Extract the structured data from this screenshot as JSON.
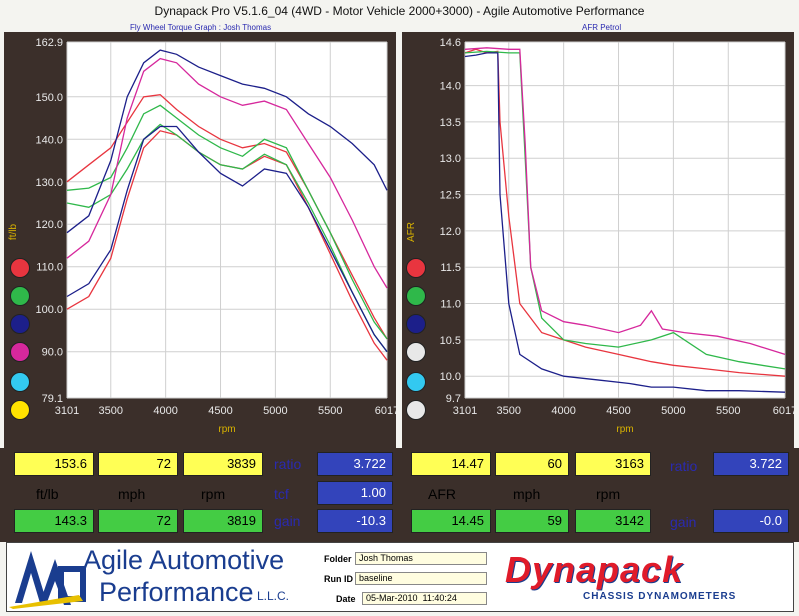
{
  "title": "Dynapack Pro V5.1.6_04 (4WD - Motor Vehicle 2000+3000) - Agile Automotive Performance",
  "colors": {
    "red": "#e8353f",
    "green": "#2fb84a",
    "blue": "#1c1f8a",
    "magenta": "#d6289c",
    "cyan": "#33c9f0",
    "yellow": "#ffe300",
    "white": "#f0f0f0"
  },
  "chart_data": [
    {
      "type": "line",
      "title": "Fly Wheel Torque Graph : Josh Thomas",
      "xlabel": "rpm",
      "ylabel": "ft/lb",
      "xlim": [
        3101,
        6017
      ],
      "ylim": [
        79.1,
        162.9
      ],
      "x_ticks": [
        "3101",
        "3500",
        "4000",
        "4500",
        "5000",
        "5500",
        "6017"
      ],
      "y_ticks": [
        "162.9",
        "150.0",
        "140.0",
        "130.0",
        "120.0",
        "110.0",
        "100.0",
        "90.0",
        "79.1"
      ],
      "grid": true,
      "series": [
        {
          "color": "red",
          "x": [
            3101,
            3300,
            3500,
            3650,
            3800,
            3950,
            4100,
            4300,
            4500,
            4700,
            4900,
            5100,
            5300,
            5500,
            5700,
            5900,
            6017
          ],
          "values": [
            130,
            134,
            138,
            144,
            150,
            150.5,
            147,
            143,
            140,
            138,
            139,
            137,
            128,
            118,
            108,
            98,
            93
          ]
        },
        {
          "color": "red",
          "x": [
            3101,
            3300,
            3500,
            3650,
            3800,
            3950,
            4100,
            4300,
            4500,
            4700,
            4900,
            5100,
            5300,
            5500,
            5700,
            5900,
            6017
          ],
          "values": [
            100,
            103,
            112,
            126,
            138,
            142,
            141,
            137,
            134,
            133,
            136,
            134,
            124,
            113,
            102,
            92,
            88
          ]
        },
        {
          "color": "green",
          "x": [
            3101,
            3300,
            3500,
            3650,
            3800,
            3950,
            4100,
            4300,
            4500,
            4700,
            4900,
            5100,
            5300,
            5500,
            5700,
            5900,
            6017
          ],
          "values": [
            128,
            128.5,
            131,
            138,
            146,
            148,
            145,
            141,
            138,
            136,
            140,
            138,
            128,
            118,
            107,
            97,
            93
          ]
        },
        {
          "color": "green",
          "x": [
            3101,
            3300,
            3500,
            3650,
            3800,
            3950,
            4100,
            4300,
            4500,
            4700,
            4900,
            5100,
            5300,
            5500,
            5700,
            5900,
            6017
          ],
          "values": [
            125,
            124,
            127,
            133,
            140,
            143.5,
            141,
            137,
            134,
            133,
            136.5,
            134,
            125,
            115,
            104,
            94,
            90
          ]
        },
        {
          "color": "blue",
          "x": [
            3101,
            3300,
            3500,
            3650,
            3800,
            3950,
            4100,
            4300,
            4500,
            4700,
            4900,
            5100,
            5300,
            5500,
            5700,
            5900,
            6017
          ],
          "values": [
            118,
            122,
            135,
            150,
            158,
            161,
            160,
            157,
            155,
            153,
            152,
            150,
            146,
            143,
            139,
            134,
            128
          ]
        },
        {
          "color": "blue",
          "x": [
            3101,
            3300,
            3500,
            3650,
            3800,
            3950,
            4100,
            4300,
            4500,
            4700,
            4900,
            5100,
            5300,
            5500,
            5700,
            5900,
            6017
          ],
          "values": [
            103,
            106,
            114,
            128,
            140,
            143,
            143,
            137,
            132,
            129,
            133,
            132,
            124,
            114,
            104,
            94,
            90
          ]
        },
        {
          "color": "magenta",
          "x": [
            3101,
            3300,
            3500,
            3650,
            3800,
            3950,
            4100,
            4300,
            4500,
            4700,
            4900,
            5100,
            5300,
            5500,
            5700,
            5900,
            6017
          ],
          "values": [
            112,
            116,
            127,
            145,
            156,
            159,
            158,
            153,
            150,
            148,
            149,
            147,
            139,
            131,
            121,
            110,
            105
          ]
        }
      ]
    },
    {
      "type": "line",
      "title": "AFR Petrol",
      "xlabel": "rpm",
      "ylabel": "AFR",
      "xlim": [
        3101,
        6017
      ],
      "ylim": [
        9.7,
        14.6
      ],
      "x_ticks": [
        "3101",
        "3500",
        "4000",
        "4500",
        "5000",
        "5500",
        "6017"
      ],
      "y_ticks": [
        "14.6",
        "14.0",
        "13.5",
        "13.0",
        "12.5",
        "12.0",
        "11.5",
        "11.0",
        "10.5",
        "10.0",
        "9.7"
      ],
      "grid": true,
      "series": [
        {
          "color": "red",
          "x": [
            3101,
            3200,
            3300,
            3400,
            3420,
            3500,
            3600,
            3800,
            4000,
            4200,
            4500,
            4800,
            5000,
            5300,
            5600,
            6017
          ],
          "values": [
            14.45,
            14.5,
            14.45,
            14.47,
            13.5,
            12.2,
            11.0,
            10.6,
            10.5,
            10.4,
            10.3,
            10.2,
            10.15,
            10.1,
            10.05,
            10.0
          ]
        },
        {
          "color": "green",
          "x": [
            3101,
            3300,
            3500,
            3600,
            3650,
            3700,
            3800,
            4000,
            4200,
            4500,
            4800,
            5000,
            5300,
            5600,
            6017
          ],
          "values": [
            14.45,
            14.47,
            14.45,
            14.45,
            13.0,
            11.5,
            10.8,
            10.5,
            10.45,
            10.4,
            10.5,
            10.6,
            10.3,
            10.2,
            10.1
          ]
        },
        {
          "color": "blue",
          "x": [
            3101,
            3200,
            3300,
            3400,
            3420,
            3500,
            3600,
            3800,
            4000,
            4300,
            4600,
            4800,
            5000,
            5300,
            5600,
            6017
          ],
          "values": [
            14.4,
            14.42,
            14.45,
            14.45,
            12.5,
            11.0,
            10.3,
            10.1,
            10.0,
            9.95,
            9.9,
            9.85,
            9.85,
            9.8,
            9.8,
            9.78
          ]
        },
        {
          "color": "magenta",
          "x": [
            3101,
            3300,
            3500,
            3600,
            3650,
            3700,
            3800,
            4000,
            4200,
            4500,
            4700,
            4800,
            4900,
            5100,
            5400,
            5700,
            6017
          ],
          "values": [
            14.5,
            14.52,
            14.5,
            14.5,
            13.2,
            11.5,
            10.9,
            10.75,
            10.7,
            10.6,
            10.7,
            10.9,
            10.65,
            10.6,
            10.55,
            10.45,
            10.3
          ]
        }
      ]
    }
  ],
  "readouts": {
    "left": {
      "row1": [
        "153.6",
        "72",
        "3839"
      ],
      "labels": [
        "ft/lb",
        "mph",
        "rpm"
      ],
      "row3": [
        "143.3",
        "72",
        "3819"
      ],
      "ratio_label": "ratio",
      "ratio": "3.722",
      "tcf_label": "tcf",
      "tcf": "1.00",
      "gain_label": "gain",
      "gain": "-10.3"
    },
    "right": {
      "row1": [
        "14.47",
        "60",
        "3163"
      ],
      "labels": [
        "AFR",
        "mph",
        "rpm"
      ],
      "row3": [
        "14.45",
        "59",
        "3142"
      ],
      "ratio_label": "ratio",
      "ratio": "3.722",
      "gain_label": "gain",
      "gain": "-0.0"
    }
  },
  "footer": {
    "logo_text": "AAP",
    "company_line1": "Agile Automotive",
    "company_line2": "Performance",
    "company_suffix": "L.L.C.",
    "folder_label": "Folder",
    "folder_value": "Josh Thomas",
    "runid_label": "Run ID",
    "runid_value": "baseline",
    "date_label": "Date",
    "date_value": "05-Mar-2010  11:40:24",
    "dynapack_logo": "Dynapack",
    "dynapack_sub": "CHASSIS DYNAMOMETERS"
  }
}
